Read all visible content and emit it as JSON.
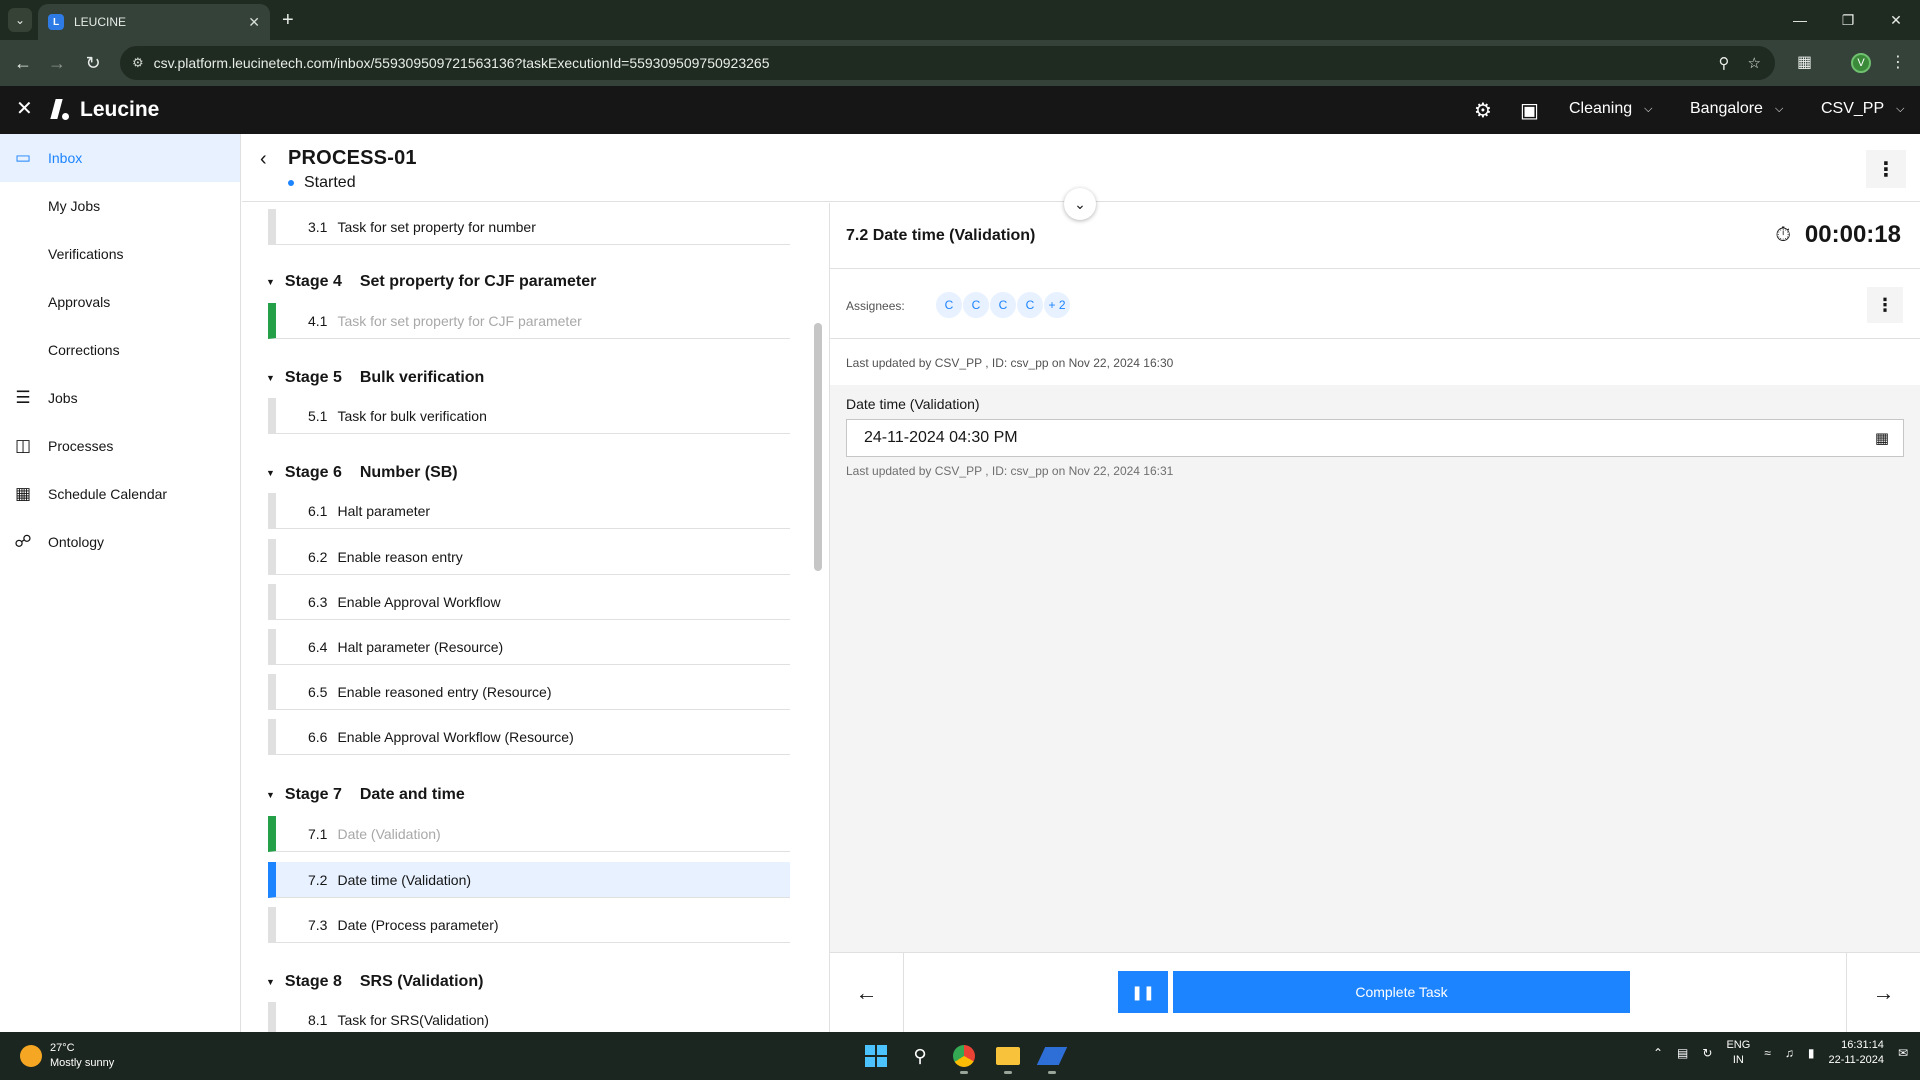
{
  "browser": {
    "tab_title": "LEUCINE",
    "url": "csv.platform.leucinetech.com/inbox/559309509721563136?taskExecutionId=559309509750923265",
    "profile_initial": "V"
  },
  "header": {
    "brand": "Leucine",
    "dropdowns": [
      "Cleaning",
      "Bangalore",
      "CSV_PP"
    ]
  },
  "sidebar": {
    "items": [
      {
        "label": "Inbox",
        "icon": "inbox-icon",
        "active": true
      },
      {
        "label": "My Jobs"
      },
      {
        "label": "Verifications"
      },
      {
        "label": "Approvals"
      },
      {
        "label": "Corrections"
      },
      {
        "label": "Jobs",
        "icon": "clipboard-icon"
      },
      {
        "label": "Processes",
        "icon": "processes-icon"
      },
      {
        "label": "Schedule Calendar",
        "icon": "calendar-icon"
      },
      {
        "label": "Ontology",
        "icon": "ontology-icon"
      }
    ]
  },
  "process": {
    "title": "PROCESS-01",
    "status": "Started"
  },
  "stages": [
    {
      "num": "",
      "name": "",
      "tasks": [
        {
          "num": "3.1",
          "name": "Task for set property for number",
          "state": "todo"
        }
      ]
    },
    {
      "num": "Stage 4",
      "name": "Set property for CJF parameter",
      "tasks": [
        {
          "num": "4.1",
          "name": "Task for set property for CJF parameter",
          "state": "done"
        }
      ]
    },
    {
      "num": "Stage 5",
      "name": "Bulk verification",
      "tasks": [
        {
          "num": "5.1",
          "name": "Task for bulk verification",
          "state": "todo"
        }
      ]
    },
    {
      "num": "Stage 6",
      "name": "Number (SB)",
      "tasks": [
        {
          "num": "6.1",
          "name": "Halt parameter",
          "state": "todo"
        },
        {
          "num": "6.2",
          "name": "Enable reason entry",
          "state": "todo"
        },
        {
          "num": "6.3",
          "name": "Enable Approval Workflow",
          "state": "todo"
        },
        {
          "num": "6.4",
          "name": "Halt parameter (Resource)",
          "state": "todo"
        },
        {
          "num": "6.5",
          "name": "Enable reasoned entry (Resource)",
          "state": "todo"
        },
        {
          "num": "6.6",
          "name": "Enable Approval Workflow (Resource)",
          "state": "todo"
        }
      ]
    },
    {
      "num": "Stage 7",
      "name": "Date and time",
      "tasks": [
        {
          "num": "7.1",
          "name": "Date (Validation)",
          "state": "done"
        },
        {
          "num": "7.2",
          "name": "Date time (Validation)",
          "state": "active"
        },
        {
          "num": "7.3",
          "name": "Date (Process parameter)",
          "state": "todo"
        }
      ]
    },
    {
      "num": "Stage 8",
      "name": "SRS (Validation)",
      "tasks": [
        {
          "num": "8.1",
          "name": "Task for SRS(Validation)",
          "state": "todo"
        }
      ]
    }
  ],
  "task_detail": {
    "title": "7.2 Date time (Validation)",
    "timer": "00:00:18",
    "assignees_label": "Assignees:",
    "assignees": [
      "C",
      "C",
      "C",
      "C",
      "+ 2"
    ],
    "last_updated": "Last updated by CSV_PP , ID: csv_pp on Nov 22, 2024 16:30",
    "field_label": "Date time (Validation)",
    "field_value": "24-11-2024 04:30 PM",
    "field_updated": "Last updated by CSV_PP , ID: csv_pp on Nov 22, 2024 16:31"
  },
  "footer": {
    "complete_label": "Complete Task"
  },
  "taskbar": {
    "temp": "27°C",
    "weather": "Mostly sunny",
    "lang1": "ENG",
    "lang2": "IN",
    "time": "16:31:14",
    "date": "22-11-2024"
  }
}
